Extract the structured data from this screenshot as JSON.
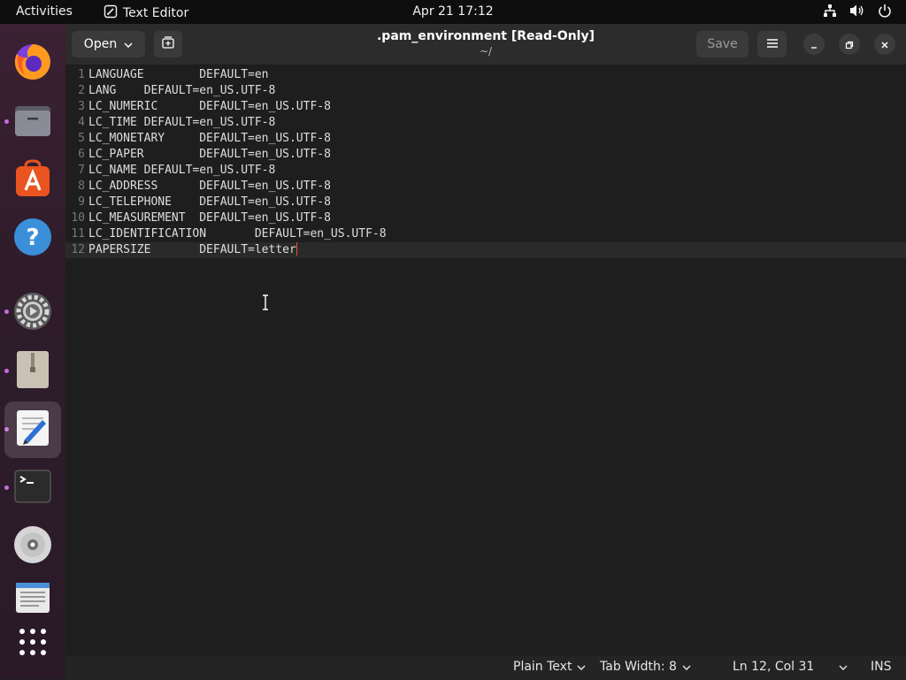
{
  "topbar": {
    "activities": "Activities",
    "app_name": "Text Editor",
    "clock": "Apr 21  17:12"
  },
  "dock": {
    "items": [
      {
        "name": "firefox-icon",
        "running": false
      },
      {
        "name": "files-icon",
        "running": true
      },
      {
        "name": "app-center-icon",
        "running": false
      },
      {
        "name": "help-icon",
        "running": false
      },
      {
        "name": "settings-icon",
        "running": true
      },
      {
        "name": "archive-manager-icon",
        "running": true
      },
      {
        "name": "text-editor-icon",
        "running": true,
        "active": true
      },
      {
        "name": "terminal-icon",
        "running": true
      },
      {
        "name": "disc-icon",
        "running": false
      },
      {
        "name": "notes-icon",
        "running": false
      },
      {
        "name": "show-apps-icon",
        "running": false
      }
    ]
  },
  "header": {
    "open_label": "Open",
    "title": ".pam_environment [Read-Only]",
    "subtitle": "~/",
    "save_label": "Save"
  },
  "editor": {
    "lines": [
      {
        "num": "1",
        "text": "LANGUAGE\tDEFAULT=en"
      },
      {
        "num": "2",
        "text": "LANG\tDEFAULT=en_US.UTF-8"
      },
      {
        "num": "3",
        "text": "LC_NUMERIC\tDEFAULT=en_US.UTF-8"
      },
      {
        "num": "4",
        "text": "LC_TIME\tDEFAULT=en_US.UTF-8"
      },
      {
        "num": "5",
        "text": "LC_MONETARY\tDEFAULT=en_US.UTF-8"
      },
      {
        "num": "6",
        "text": "LC_PAPER\tDEFAULT=en_US.UTF-8"
      },
      {
        "num": "7",
        "text": "LC_NAME\tDEFAULT=en_US.UTF-8"
      },
      {
        "num": "8",
        "text": "LC_ADDRESS\tDEFAULT=en_US.UTF-8"
      },
      {
        "num": "9",
        "text": "LC_TELEPHONE\tDEFAULT=en_US.UTF-8"
      },
      {
        "num": "10",
        "text": "LC_MEASUREMENT\tDEFAULT=en_US.UTF-8"
      },
      {
        "num": "11",
        "text": "LC_IDENTIFICATION\tDEFAULT=en_US.UTF-8"
      },
      {
        "num": "12",
        "text": "PAPERSIZE\tDEFAULT=letter"
      }
    ],
    "current_line": 12
  },
  "status": {
    "language": "Plain Text",
    "tab_width": "Tab Width: 8",
    "cursor_pos": "Ln 12, Col 31",
    "mode": "INS"
  },
  "colors": {
    "accent": "#e95420",
    "dock_running_dot": "#c96ae8"
  }
}
